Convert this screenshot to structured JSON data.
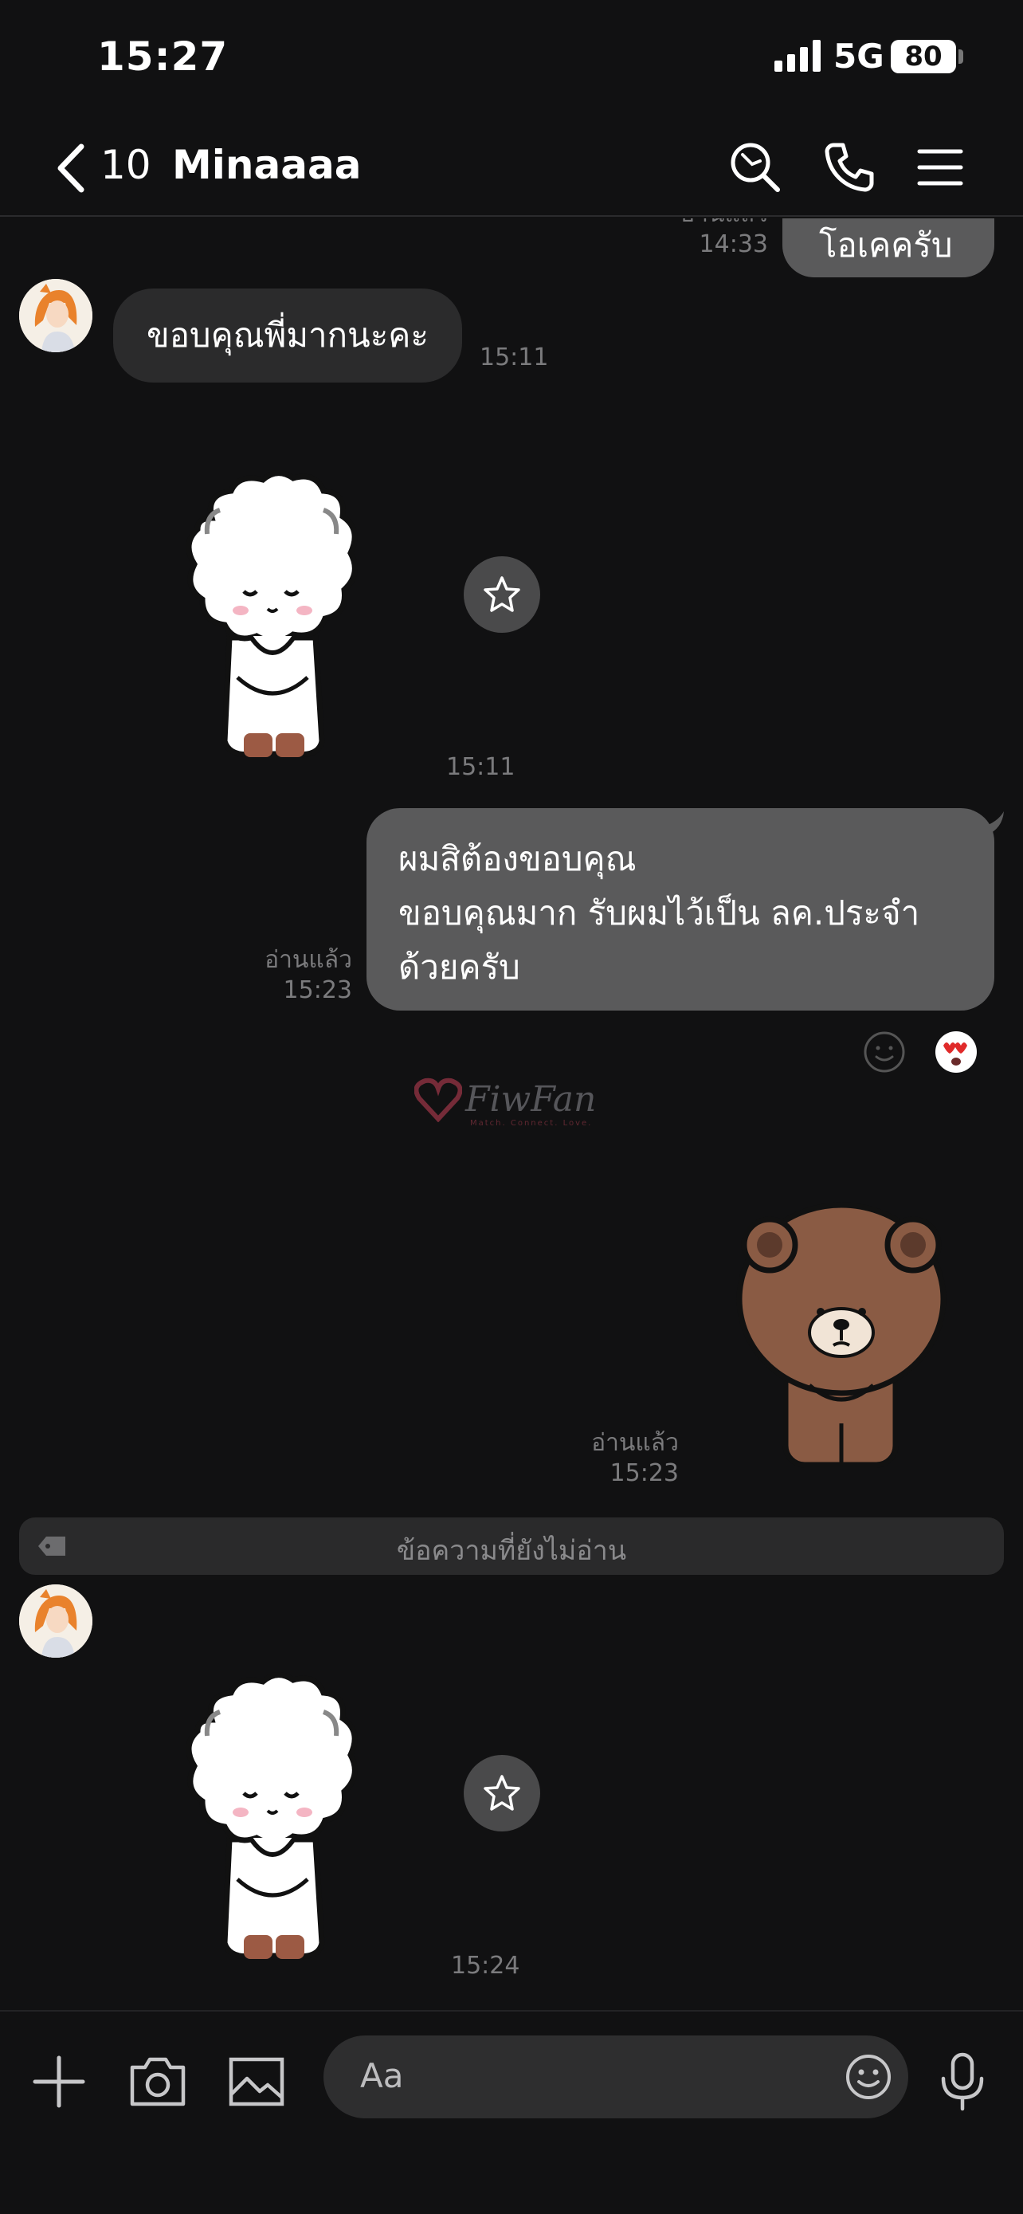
{
  "status_bar": {
    "time": "15:27",
    "network": "5G",
    "battery": "80"
  },
  "header": {
    "unread_count": "10",
    "chat_name": "Minaaaa"
  },
  "messages": {
    "top_partial": {
      "read": "อ่านแล้ว",
      "time": "14:33",
      "text": "โอเคครับ"
    },
    "m1": {
      "text": "ขอบคุณพี่มากนะคะ",
      "time": "15:11"
    },
    "m2": {
      "time": "15:11"
    },
    "m3": {
      "line1": "ผมสิต้องขอบคุณ",
      "line2": "ขอบคุณมาก รับผมไว้เป็น ลค.ประจำ",
      "line3": "ด้วยครับ",
      "read": "อ่านแล้ว",
      "time": "15:23"
    },
    "m4": {
      "read": "อ่านแล้ว",
      "time": "15:23"
    },
    "unread_divider": "ข้อความที่ยังไม่อ่าน",
    "m5": {
      "time": "15:24"
    }
  },
  "watermark": {
    "text": "FiwFan",
    "tagline": "Match. Connect. Love."
  },
  "input": {
    "placeholder": "Aa"
  }
}
